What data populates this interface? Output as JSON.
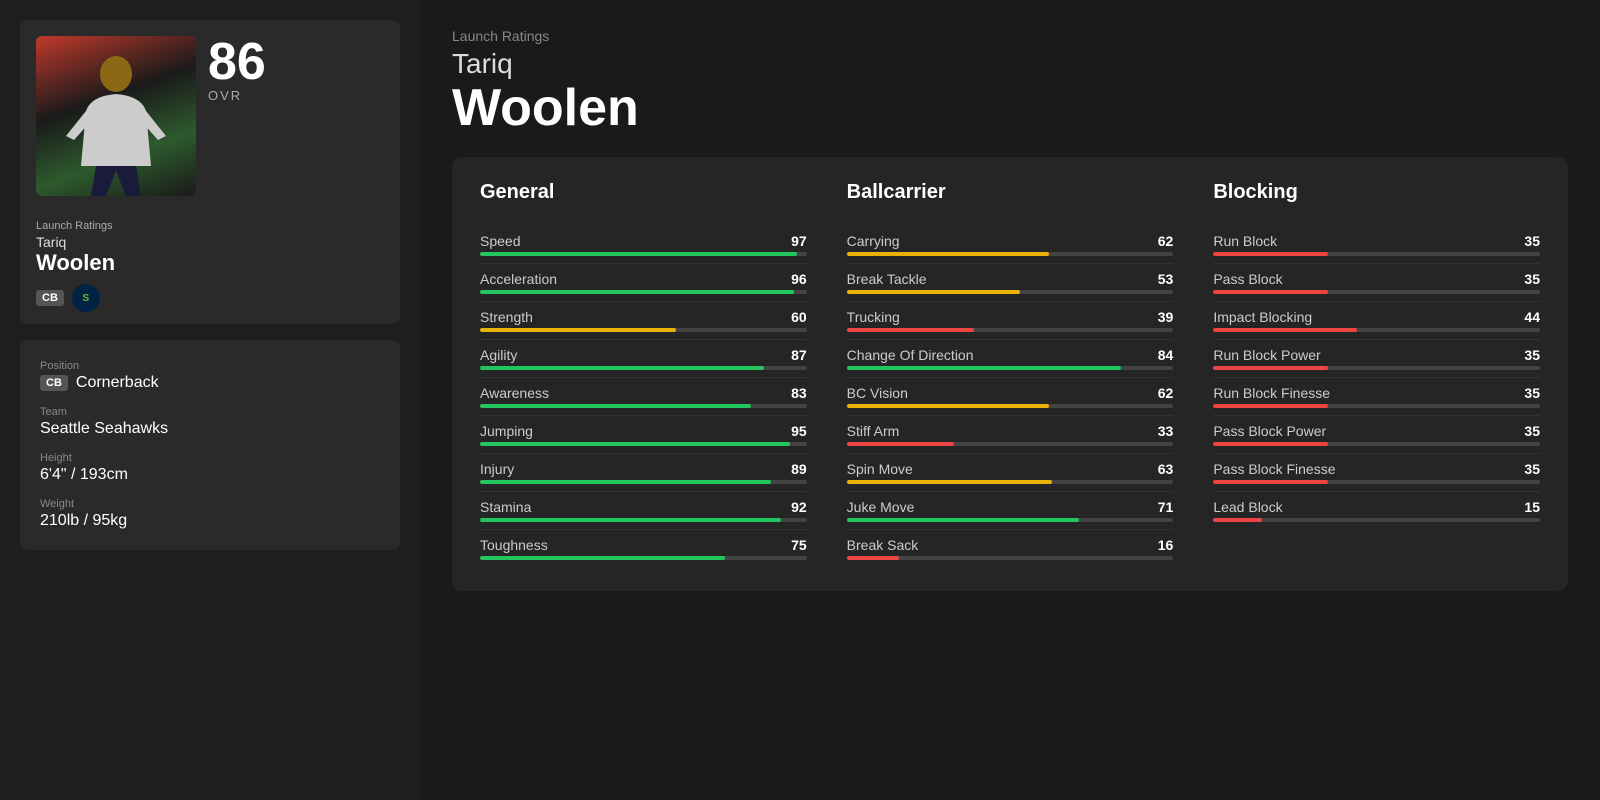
{
  "leftPanel": {
    "launchRatingsLabel": "Launch Ratings",
    "playerFirstName": "Tariq",
    "playerLastName": "Woolen",
    "ovr": "86",
    "ovrLabel": "OVR",
    "position": "CB",
    "positionFull": "Cornerback",
    "team": "Seattle Seahawks",
    "height": "6'4\" / 193cm",
    "weight": "210lb / 95kg",
    "positionLabel": "Position",
    "teamLabel": "Team",
    "heightLabel": "Height",
    "weightLabel": "Weight"
  },
  "header": {
    "launchRatingsLabel": "Launch Ratings",
    "playerFirstName": "Tariq",
    "playerLastName": "Woolen"
  },
  "columns": {
    "general": {
      "title": "General",
      "items": [
        {
          "name": "Speed",
          "value": 97,
          "barColor": "green"
        },
        {
          "name": "Acceleration",
          "value": 96,
          "barColor": "green"
        },
        {
          "name": "Strength",
          "value": 60,
          "barColor": "yellow"
        },
        {
          "name": "Agility",
          "value": 87,
          "barColor": "green"
        },
        {
          "name": "Awareness",
          "value": 83,
          "barColor": "green"
        },
        {
          "name": "Jumping",
          "value": 95,
          "barColor": "green"
        },
        {
          "name": "Injury",
          "value": 89,
          "barColor": "green"
        },
        {
          "name": "Stamina",
          "value": 92,
          "barColor": "green"
        },
        {
          "name": "Toughness",
          "value": 75,
          "barColor": "green"
        }
      ]
    },
    "ballcarrier": {
      "title": "Ballcarrier",
      "items": [
        {
          "name": "Carrying",
          "value": 62,
          "barColor": "yellow"
        },
        {
          "name": "Break Tackle",
          "value": 53,
          "barColor": "yellow"
        },
        {
          "name": "Trucking",
          "value": 39,
          "barColor": "red"
        },
        {
          "name": "Change Of Direction",
          "value": 84,
          "barColor": "green"
        },
        {
          "name": "BC Vision",
          "value": 62,
          "barColor": "yellow"
        },
        {
          "name": "Stiff Arm",
          "value": 33,
          "barColor": "red"
        },
        {
          "name": "Spin Move",
          "value": 63,
          "barColor": "yellow"
        },
        {
          "name": "Juke Move",
          "value": 71,
          "barColor": "green"
        },
        {
          "name": "Break Sack",
          "value": 16,
          "barColor": "red"
        }
      ]
    },
    "blocking": {
      "title": "Blocking",
      "items": [
        {
          "name": "Run Block",
          "value": 35,
          "barColor": "red"
        },
        {
          "name": "Pass Block",
          "value": 35,
          "barColor": "red"
        },
        {
          "name": "Impact Blocking",
          "value": 44,
          "barColor": "red"
        },
        {
          "name": "Run Block Power",
          "value": 35,
          "barColor": "red"
        },
        {
          "name": "Run Block Finesse",
          "value": 35,
          "barColor": "red"
        },
        {
          "name": "Pass Block Power",
          "value": 35,
          "barColor": "red"
        },
        {
          "name": "Pass Block Finesse",
          "value": 35,
          "barColor": "red"
        },
        {
          "name": "Lead Block",
          "value": 15,
          "barColor": "red"
        }
      ]
    }
  }
}
